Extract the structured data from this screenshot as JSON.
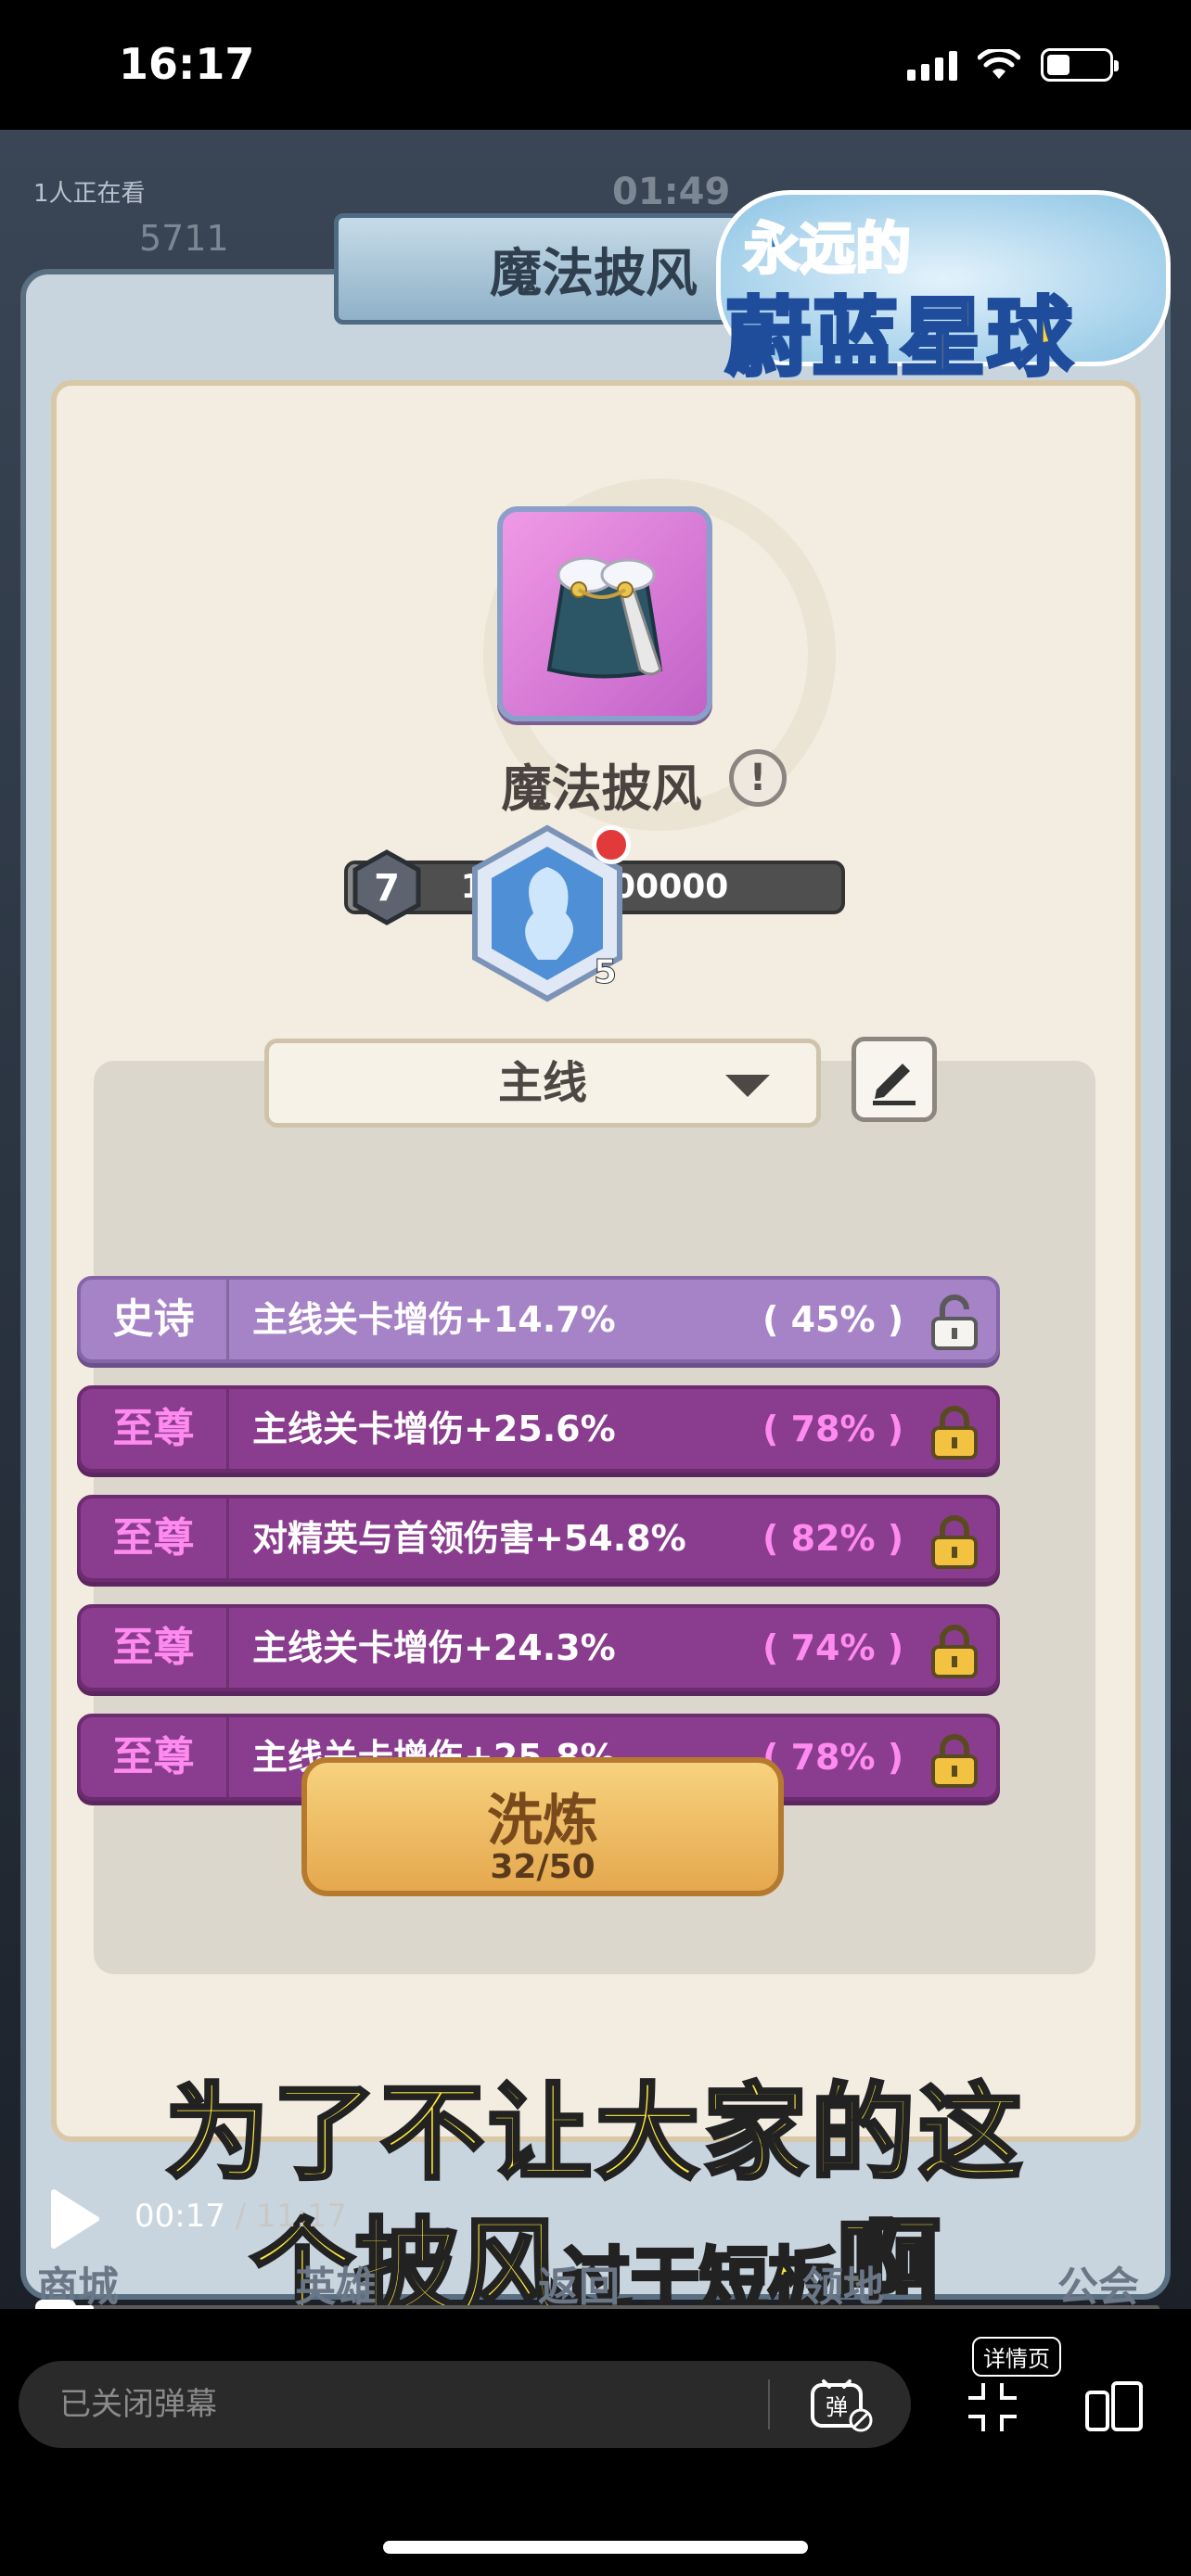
{
  "status_bar": {
    "time": "16:17"
  },
  "stream_overlay": {
    "viewers": "1人正在看",
    "timer": "01:49",
    "ghost_number": "5711"
  },
  "game": {
    "window_title": "魔法披风",
    "logo_line1": "永远的",
    "logo_line2": "蔚蓝星球",
    "item": {
      "name": "魔法披风",
      "info_symbol": "!",
      "level": "7",
      "progress_text": "16800/600000",
      "progress_value": 0.028
    },
    "gem": {
      "count": "5"
    },
    "mode_dropdown": {
      "selected": "主线"
    },
    "stats": [
      {
        "rank": "史诗",
        "desc": "主线关卡增伤+14.7%",
        "pct": "( 45% )",
        "tier": "epic",
        "locked": false
      },
      {
        "rank": "至尊",
        "desc": "主线关卡增伤+25.6%",
        "pct": "( 78% )",
        "tier": "supreme",
        "locked": true
      },
      {
        "rank": "至尊",
        "desc": "对精英与首领伤害+54.8%",
        "pct": "( 82% )",
        "tier": "supreme",
        "locked": true
      },
      {
        "rank": "至尊",
        "desc": "主线关卡增伤+24.3%",
        "pct": "( 74% )",
        "tier": "supreme",
        "locked": true
      },
      {
        "rank": "至尊",
        "desc": "主线关卡增伤+25.8%",
        "pct": "( 78% )",
        "tier": "supreme",
        "locked": true
      }
    ],
    "refine_button": {
      "label": "洗炼",
      "cost": "32/50"
    },
    "bottom_nav": [
      "商城",
      "英雄",
      "返回",
      "领地",
      "公会"
    ]
  },
  "subtitle": {
    "line1": "为了不让大家的这",
    "line2_big": "个披风",
    "line2_small": "过于短板",
    "line2_end": "啊"
  },
  "player": {
    "current_time": "00:17",
    "duration": "/ 11:17",
    "progress": 0.026
  },
  "toolbar": {
    "danmaku_placeholder": "已关闭弹幕",
    "detail_label": "详情页"
  },
  "colors": {
    "epic": "#a682c6",
    "supreme": "#8a3d8e",
    "subtitle": "#ffe93b",
    "gold_button": "#f0c06a"
  }
}
